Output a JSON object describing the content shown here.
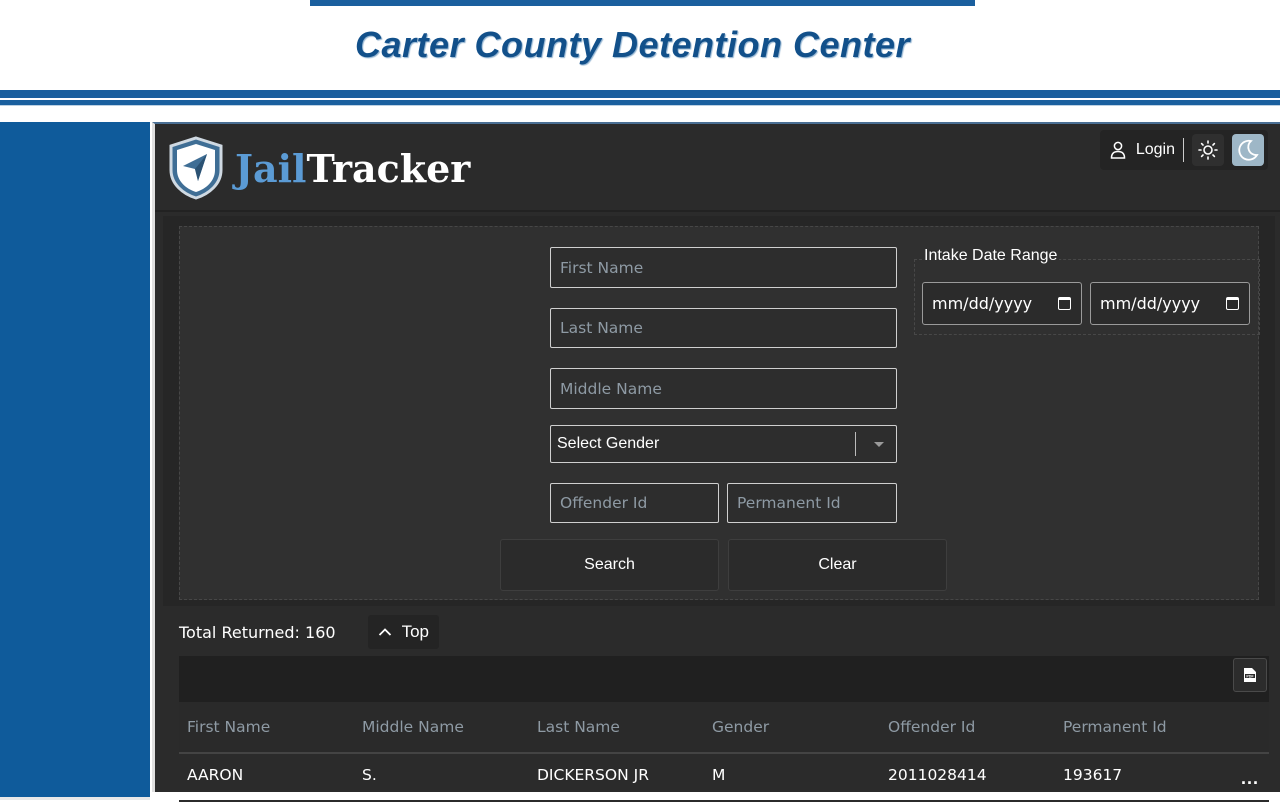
{
  "banner": {
    "title": "Carter County Detention Center"
  },
  "header": {
    "logo_jail": "Jail",
    "logo_tracker": "Tracker",
    "login_label": "Login"
  },
  "search": {
    "first_name_placeholder": "First Name",
    "last_name_placeholder": "Last Name",
    "middle_name_placeholder": "Middle Name",
    "gender_select": "Select Gender",
    "offender_id_placeholder": "Offender Id",
    "permanent_id_placeholder": "Permanent Id",
    "intake_legend": "Intake Date Range",
    "date_from_placeholder": "mm/dd/yyyy",
    "date_to_placeholder": "mm/dd/yyyy",
    "search_label": "Search",
    "clear_label": "Clear"
  },
  "results": {
    "total_label": "Total Returned: 160",
    "top_label": "Top",
    "columns": [
      "First Name",
      "Middle Name",
      "Last Name",
      "Gender",
      "Offender Id",
      "Permanent Id"
    ],
    "rows": [
      [
        "AARON",
        "S.",
        "DICKERSON JR",
        "M",
        "2011028414",
        "193617"
      ]
    ],
    "more_label": "..."
  },
  "colors": {
    "brand_blue": "#1a5f9e",
    "logo_blue": "#5b9bd5",
    "panel_dark": "#2b2b2b"
  }
}
